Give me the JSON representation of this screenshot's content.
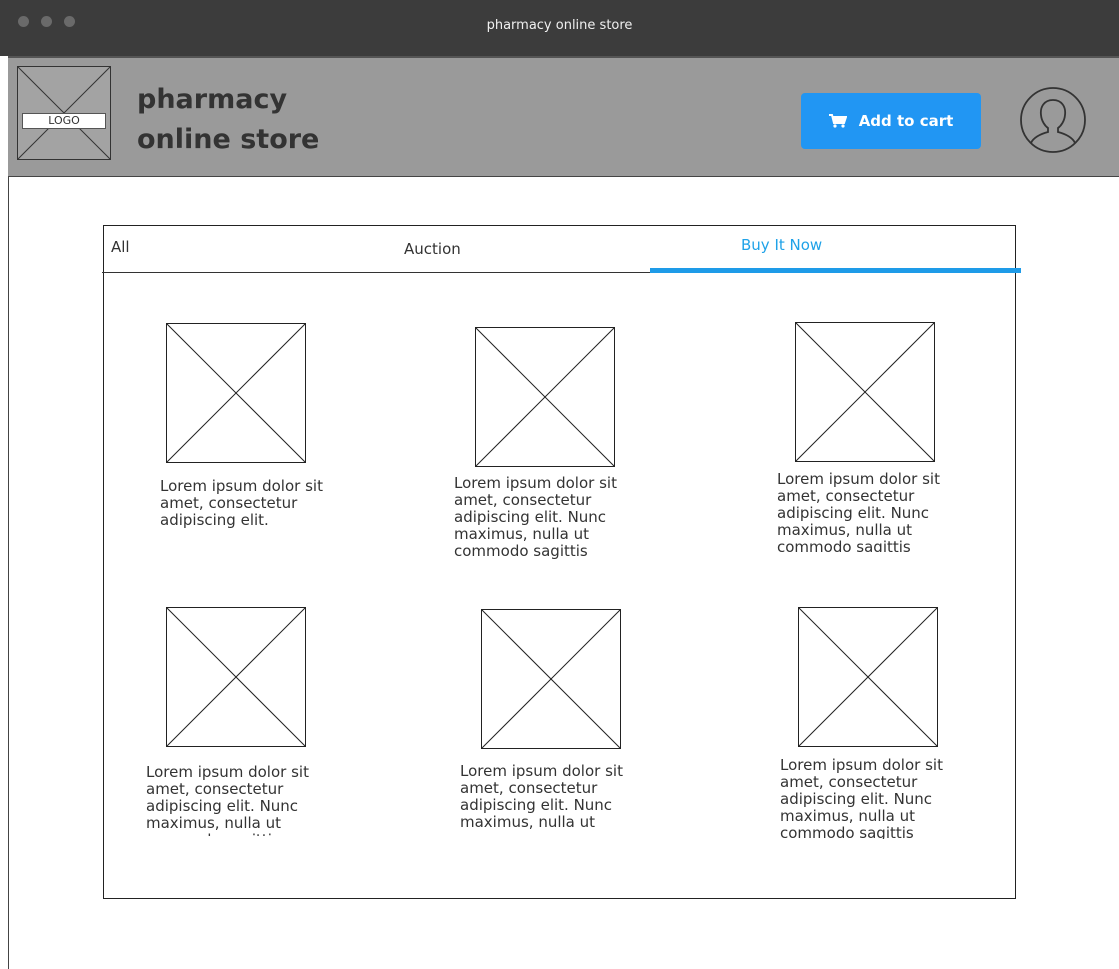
{
  "window": {
    "title": "pharmacy online store"
  },
  "header": {
    "logo_label": "LOGO",
    "brand_line1": "pharmacy",
    "brand_line2": "online store",
    "cart_button": "Add to cart"
  },
  "tabs": [
    {
      "label": "All"
    },
    {
      "label": "Auction"
    },
    {
      "label": "Buy It Now",
      "active": true
    }
  ],
  "colors": {
    "accent": "#2196f3",
    "active_tab": "#1fa2e8",
    "header_bg": "#9a9a9a"
  },
  "icons": [
    "cart-icon",
    "user-avatar-icon"
  ],
  "products": [
    {
      "description": "Lorem ipsum dolor sit amet, consectetur adipiscing elit."
    },
    {
      "description": "Lorem ipsum dolor sit amet, consectetur adipiscing elit. Nunc maximus, nulla ut commodo sagittis"
    },
    {
      "description": "Lorem ipsum dolor sit amet, consectetur adipiscing elit. Nunc maximus, nulla ut commodo sagittis"
    },
    {
      "description": "Lorem ipsum dolor sit amet, consectetur adipiscing elit. Nunc maximus, nulla ut commodo sagittis"
    },
    {
      "description": "Lorem ipsum dolor sit amet, consectetur adipiscing elit. Nunc maximus, nulla ut"
    },
    {
      "description": "Lorem ipsum dolor sit amet, consectetur adipiscing elit. Nunc maximus, nulla ut commodo sagittis"
    }
  ]
}
